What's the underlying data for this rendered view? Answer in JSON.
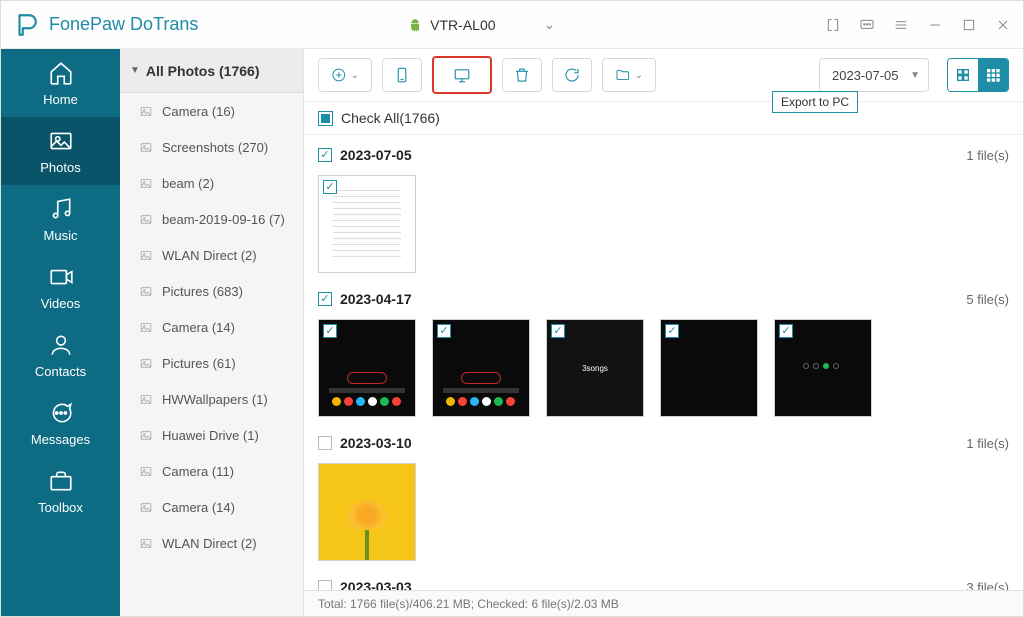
{
  "app_title": "FonePaw DoTrans",
  "device_name": "VTR-AL00",
  "tooltip_export": "Export to PC",
  "nav": [
    {
      "label": "Home"
    },
    {
      "label": "Photos"
    },
    {
      "label": "Music"
    },
    {
      "label": "Videos"
    },
    {
      "label": "Contacts"
    },
    {
      "label": "Messages"
    },
    {
      "label": "Toolbox"
    }
  ],
  "albums_header": "All Photos (1766)",
  "albums": [
    {
      "label": "Camera (16)"
    },
    {
      "label": "Screenshots (270)"
    },
    {
      "label": "beam (2)"
    },
    {
      "label": "beam-2019-09-16 (7)"
    },
    {
      "label": "WLAN Direct (2)"
    },
    {
      "label": "Pictures (683)"
    },
    {
      "label": "Camera (14)"
    },
    {
      "label": "Pictures (61)"
    },
    {
      "label": "HWWallpapers (1)"
    },
    {
      "label": "Huawei Drive (1)"
    },
    {
      "label": "Camera (11)"
    },
    {
      "label": "Camera (14)"
    },
    {
      "label": "WLAN Direct (2)"
    }
  ],
  "date_filter": "2023-07-05",
  "check_all_label": "Check All(1766)",
  "groups": [
    {
      "date": "2023-07-05",
      "count": "1 file(s)",
      "checked": true,
      "thumbs": 1
    },
    {
      "date": "2023-04-17",
      "count": "5 file(s)",
      "checked": true,
      "thumbs": 5
    },
    {
      "date": "2023-03-10",
      "count": "1 file(s)",
      "checked": false,
      "thumbs": 1
    },
    {
      "date": "2023-03-03",
      "count": "3 file(s)",
      "checked": false,
      "thumbs": 0
    }
  ],
  "status_text": "Total: 1766 file(s)/406.21 MB; Checked: 6 file(s)/2.03 MB"
}
